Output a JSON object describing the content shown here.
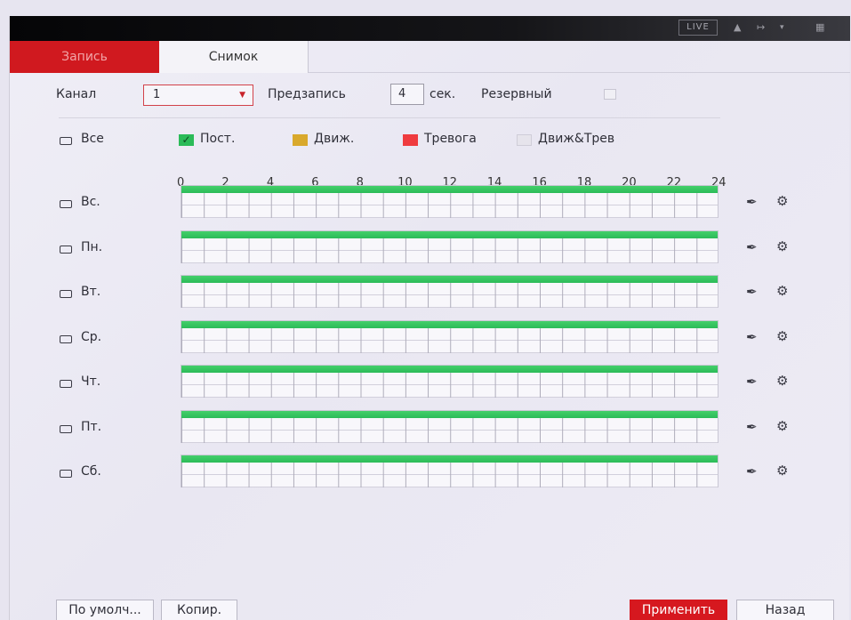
{
  "topbar": {
    "live_label": "LIVE",
    "user_icon": "user-icon",
    "logout_icon": "logout-icon",
    "qr_icon": "qr-icon"
  },
  "tabs": [
    {
      "label": "Запись",
      "active": true
    },
    {
      "label": "Снимок",
      "active": false
    }
  ],
  "settings": {
    "channel_label": "Канал",
    "channel_value": "1",
    "prerecord_label": "Предзапись",
    "prerecord_value": "4",
    "prerecord_unit": "сек.",
    "reserve_label": "Резервный"
  },
  "legend": {
    "all_label": "Все",
    "items": [
      {
        "label": "Пост.",
        "color": "#2bbb58",
        "checked": true
      },
      {
        "label": "Движ.",
        "color": "#d9a92c",
        "checked": false
      },
      {
        "label": "Тревога",
        "color": "#ef3b3f",
        "checked": false
      },
      {
        "label": "Движ&Трев",
        "color": "#e6e4ec",
        "checked": false
      }
    ]
  },
  "hours": [
    "0",
    "2",
    "4",
    "6",
    "8",
    "10",
    "12",
    "14",
    "16",
    "18",
    "20",
    "22",
    "24"
  ],
  "days": [
    {
      "label": "Вс.",
      "schedule": "Пост.",
      "coverage": 1.0
    },
    {
      "label": "Пн.",
      "schedule": "Пост.",
      "coverage": 1.0
    },
    {
      "label": "Вт.",
      "schedule": "Пост.",
      "coverage": 1.0
    },
    {
      "label": "Ср.",
      "schedule": "Пост.",
      "coverage": 1.0
    },
    {
      "label": "Чт.",
      "schedule": "Пост.",
      "coverage": 1.0
    },
    {
      "label": "Пт.",
      "schedule": "Пост.",
      "coverage": 1.0
    },
    {
      "label": "Сб.",
      "schedule": "Пост.",
      "coverage": 1.0
    }
  ],
  "row_icons": {
    "edit": "pencil-icon",
    "settings": "gear-icon"
  },
  "buttons": {
    "default_label": "По умолч...",
    "copy_label": "Копир.",
    "apply_label": "Применить",
    "back_label": "Назад"
  },
  "colors": {
    "accent": "#d6181f",
    "record_green": "#2bbb58"
  }
}
